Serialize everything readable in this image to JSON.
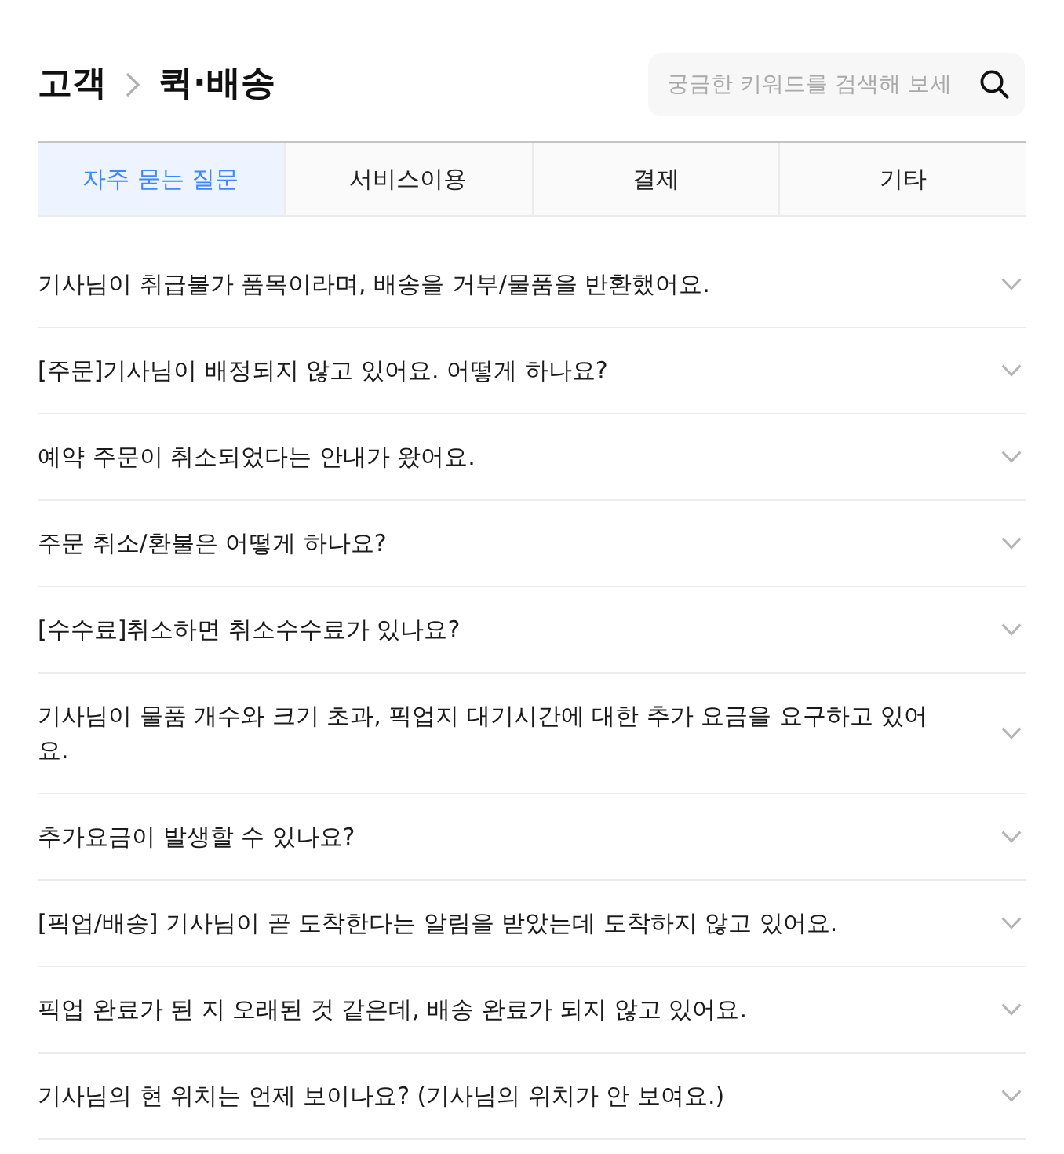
{
  "breadcrumb": [
    {
      "label": "고객"
    },
    {
      "label": "퀵·배송"
    }
  ],
  "search": {
    "placeholder": "궁금한 키워드를 검색해 보세"
  },
  "tabs": [
    {
      "label": "자주 묻는 질문",
      "selected": true
    },
    {
      "label": "서비스이용",
      "selected": false
    },
    {
      "label": "결제",
      "selected": false
    },
    {
      "label": "기타",
      "selected": false
    }
  ],
  "faq": [
    {
      "question": "기사님이 취급불가 품목이라며, 배송을 거부/물품을 반환했어요.",
      "expanded": false
    },
    {
      "question": "[주문]기사님이 배정되지 않고 있어요. 어떻게 하나요?",
      "expanded": false
    },
    {
      "question": "예약 주문이 취소되었다는 안내가 왔어요.",
      "expanded": false
    },
    {
      "question": "주문 취소/환불은 어떻게 하나요?",
      "expanded": false
    },
    {
      "question": "[수수료]취소하면 취소수수료가 있나요?",
      "expanded": false
    },
    {
      "question": "기사님이 물품 개수와 크기 초과, 픽업지 대기시간에 대한 추가 요금을 요구하고 있어요.",
      "expanded": false
    },
    {
      "question": "추가요금이 발생할 수 있나요?",
      "expanded": false
    },
    {
      "question": "[픽업/배송] 기사님이 곧 도착한다는 알림을 받았는데 도착하지 않고 있어요.",
      "expanded": false
    },
    {
      "question": "픽업 완료가 된 지 오래된 것 같은데, 배송 완료가 되지 않고 있어요.",
      "expanded": false
    },
    {
      "question": "기사님의 현 위치는 언제 보이나요? (기사님의 위치가 안 보여요.)",
      "expanded": false
    }
  ]
}
